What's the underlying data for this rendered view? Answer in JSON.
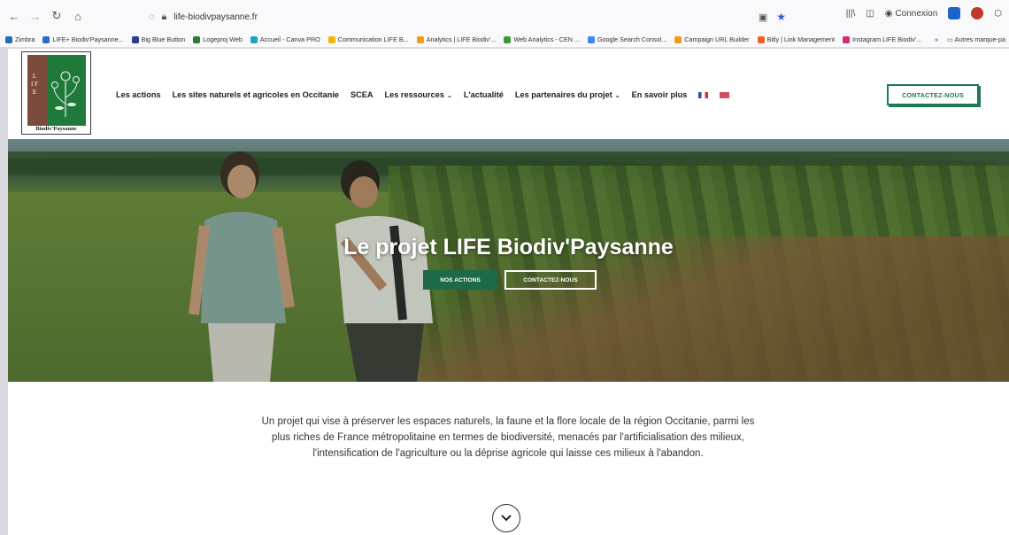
{
  "browser": {
    "url": "life-biodivpaysanne.fr",
    "account_label": "Connexion",
    "bookmarks": [
      {
        "label": "Zimbra",
        "color": "#1f6fb5"
      },
      {
        "label": "LIFE+ Biodiv'Paysanne...",
        "color": "#2a6fc9"
      },
      {
        "label": "Big Blue Button",
        "color": "#2a3f8f"
      },
      {
        "label": "Logeproj Web",
        "color": "#2e7d32"
      },
      {
        "label": "Accueil - Canva PRO",
        "color": "#1fa3c4"
      },
      {
        "label": "Communication LIFE B...",
        "color": "#f2b705"
      },
      {
        "label": "Analytics | LIFE Biodiv'...",
        "color": "#f29c11"
      },
      {
        "label": "Web Analytics - CEN ...",
        "color": "#3a9a3a"
      },
      {
        "label": "Google Search Consol...",
        "color": "#4285f4"
      },
      {
        "label": "Campaign URL Builder",
        "color": "#f09b1a"
      },
      {
        "label": "Bitly | Link Management",
        "color": "#ee6123"
      },
      {
        "label": "Instagram LIFE Biodiv'...",
        "color": "#d62976"
      }
    ],
    "bookmarks_more": "»",
    "other_bookmarks": "Autres marque-pa"
  },
  "site": {
    "logo_letters": "L I F E",
    "logo_name": "Biodiv'Paysanne",
    "nav": [
      {
        "label": "Les actions",
        "dropdown": false
      },
      {
        "label": "Les sites naturels et agricoles en Occitanie",
        "dropdown": false
      },
      {
        "label": "SCEA",
        "dropdown": false
      },
      {
        "label": "Les ressources",
        "dropdown": true
      },
      {
        "label": "L'actualité",
        "dropdown": false
      },
      {
        "label": "Les partenaires du projet",
        "dropdown": true
      },
      {
        "label": "En savoir plus",
        "dropdown": false
      }
    ],
    "contact_top": "CONTACTEZ-NOUS",
    "hero": {
      "title": "Le projet LIFE Biodiv'Paysanne",
      "btn_actions": "NOS ACTIONS",
      "btn_contact": "CONTACTEZ-NOUS"
    },
    "intro_text": "Un projet qui vise à préserver les espaces naturels, la faune et la flore locale de la région Occitanie, parmi les plus riches de France métropolitaine en termes de biodiversité, menacés par l'artificialisation des milieux, l'intensification de l'agriculture ou la déprise agricole qui laisse ces milieux à l'abandon."
  },
  "colors": {
    "brand_green": "#1d6a47",
    "accent_green": "#1d7a52"
  }
}
